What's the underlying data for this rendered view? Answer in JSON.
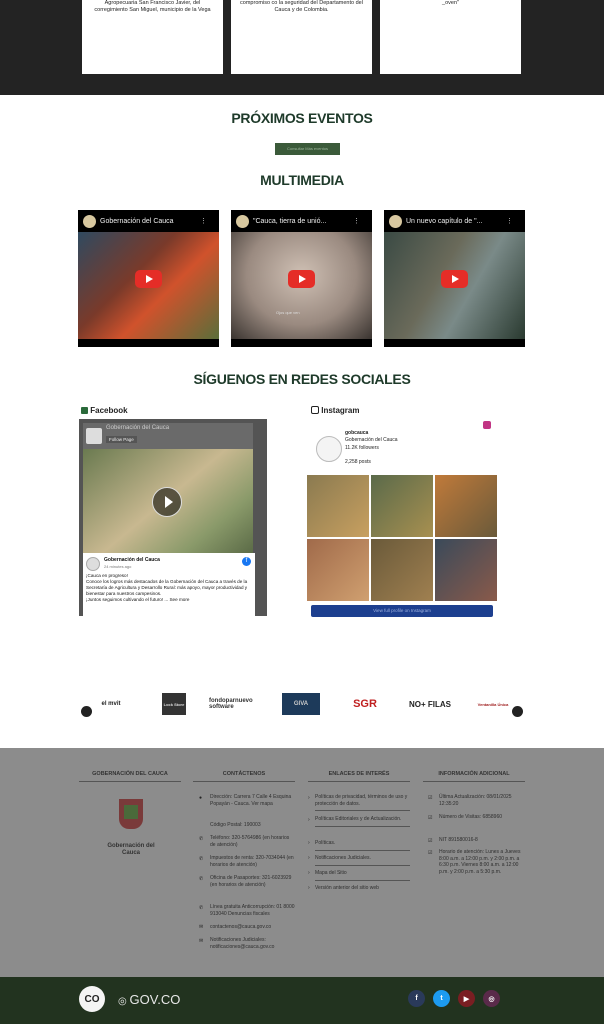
{
  "top_cards": [
    {
      "text": "Agropecuaria San Francisco Javier, del corregimiento San Miguel, municipio de la Vega"
    },
    {
      "text": "compromiso co la seguridad del Departamento del Cauca y de Colombia."
    },
    {
      "text": "_oven\""
    }
  ],
  "events": {
    "title": "PRÓXIMOS EVENTOS",
    "button_label": "Consultar Más eventos"
  },
  "multimedia": {
    "title": "MULTIMEDIA",
    "videos": [
      {
        "title": "Gobernación del Cauca"
      },
      {
        "title": "\"Cauca, tierra de unió..."
      },
      {
        "title": "Un nuevo capítulo de \"..."
      }
    ],
    "video2_caption": "Ojos que ven"
  },
  "social": {
    "title": "SÍGUENOS EN REDES SOCIALES",
    "facebook": {
      "label": "Facebook",
      "page_name": "Gobernación del Cauca",
      "follow": "Follow Page",
      "post_author": "Gobernación del Cauca",
      "post_time": "24 minutes ago",
      "post_line1": "¡Cauca en progreso!",
      "post_line2": "Conoce los logros más destacados de la Gobernación del Cauca a través de la Secretaría de Agricultura y Desarrollo Rural: más apoyo, mayor productividad y bienestar para nuestros campesinos.",
      "post_line3": "¡Juntos seguimos cultivando el futuro! ... See more"
    },
    "instagram": {
      "label": "Instagram",
      "handle": "gobcauca",
      "name": "Gobernación del Cauca",
      "followers": "11.2K followers",
      "posts": "2,258 posts",
      "button_label": "View full profile on Instagram"
    }
  },
  "logos": [
    {
      "text": "el mvit"
    },
    {
      "text": "Lock Store"
    },
    {
      "text": "fondoparnuevo software"
    },
    {
      "text": "GIVA"
    },
    {
      "text": "SGR"
    },
    {
      "text": "NO+ FILAS"
    },
    {
      "text": "Ventanilla Única"
    }
  ],
  "footer": {
    "columns": [
      {
        "title": "GOBERNACIÓN DEL CAUCA"
      },
      {
        "title": "CONTÁCTENOS"
      },
      {
        "title": "ENLACES DE INTERÉS"
      },
      {
        "title": "INFORMACIÓN ADICIONAL"
      }
    ],
    "logo_caption": "Gobernación del Cauca",
    "contact": [
      "Dirección: Carrera 7 Calle 4 Esquina Popayán - Cauca. Ver mapa",
      "Código Postal: 190003",
      "Teléfono: 320-5764986 (en horarios de atención)",
      "Impuestos de renta: 320-7034044 (en horarios de atención)",
      "Oficina de Pasaportes: 321-6023929 (en horarios de atención)",
      "Línea gratuita Anticorrupción: 01 8000 913040 Denuncias fiscales",
      "contactenos@cauca.gov.co",
      "Notificaciones Judiciales: notificaciones@cauca.gov.co"
    ],
    "links": [
      "Políticas de privacidad, términos de uso y protección de datos.",
      "Políticas Editoriales y de Actualización.",
      "Políticas.",
      "Notificaciones Judiciales.",
      "Mapa del Sitio",
      "Versión anterior del sitio web"
    ],
    "info": [
      "Última Actualización: 08/01/2025 12:35:20",
      "Número de Visitas: 6858960",
      "NIT 891580016-8",
      "Horario de atención: Lunes a Jueves 8:00 a.m. a 12:00 p.m. y 2:00 p.m. a 6:30 p.m. Viernes 8:00 a.m. a 12:00 p.m. y 2:00 p.m. a 5:30 p.m."
    ]
  },
  "bottom": {
    "co_text": "CO",
    "gov_text": "GOV.CO"
  },
  "colors": {
    "footer_bg": "#8c8c8c",
    "bottom_bg": "#22331f",
    "title_green": "#1e3a2a"
  }
}
